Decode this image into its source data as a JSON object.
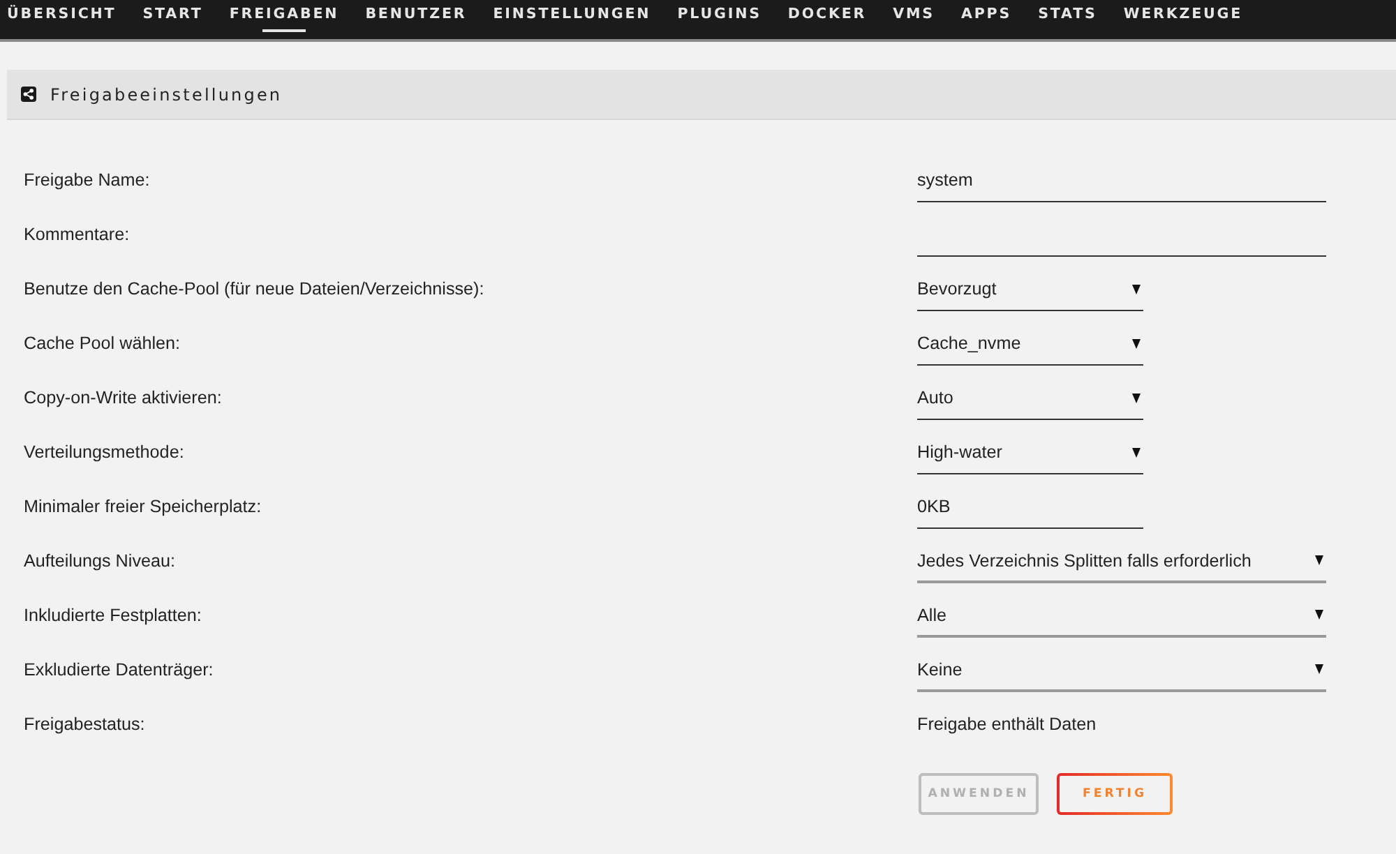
{
  "nav": {
    "tabs": [
      {
        "label": "ÜBERSICHT",
        "selected": false
      },
      {
        "label": "START",
        "selected": false
      },
      {
        "label": "FREIGABEN",
        "selected": true
      },
      {
        "label": "BENUTZER",
        "selected": false
      },
      {
        "label": "EINSTELLUNGEN",
        "selected": false
      },
      {
        "label": "PLUGINS",
        "selected": false
      },
      {
        "label": "DOCKER",
        "selected": false
      },
      {
        "label": "VMS",
        "selected": false
      },
      {
        "label": "APPS",
        "selected": false
      },
      {
        "label": "STATS",
        "selected": false
      },
      {
        "label": "WERKZEUGE",
        "selected": false
      }
    ]
  },
  "panel": {
    "title": "Freigabeeinstellungen"
  },
  "fields": [
    {
      "label": "Freigabe Name:",
      "kind": "textbox",
      "value": "system"
    },
    {
      "label": "Kommentare:",
      "kind": "textbox"
    },
    {
      "label": "Benutze den Cache-Pool (für neue Dateien/Verzeichnisse):",
      "kind": "dropdown",
      "value": "Bevorzugt"
    },
    {
      "label": "Cache Pool wählen:",
      "kind": "dropdown",
      "value": "Cache_nvme"
    },
    {
      "label": "Copy-on-Write aktivieren:",
      "kind": "dropdown",
      "value": "Auto"
    },
    {
      "label": "Verteilungsmethode:",
      "kind": "dropdown",
      "value": "High-water"
    },
    {
      "label": "Minimaler freier Speicherplatz:",
      "kind": "shortbox",
      "value": "0KB"
    },
    {
      "label": "Aufteilungs Niveau:",
      "kind": "longdropdown",
      "value": "Jedes Verzeichnis Splitten falls erforderlich"
    },
    {
      "label": "Inkludierte Festplatten:",
      "kind": "longdropdown",
      "value": "Alle"
    },
    {
      "label": "Exkludierte Datenträger:",
      "kind": "longdropdown",
      "value": "Keine"
    },
    {
      "label": "Freigabestatus:",
      "kind": "status",
      "value": "Freigabe enthält Daten"
    }
  ],
  "buttons": [
    {
      "label": "ANWENDEN",
      "disabled": true
    },
    {
      "label": "FERTIG",
      "disabled": false
    }
  ]
}
